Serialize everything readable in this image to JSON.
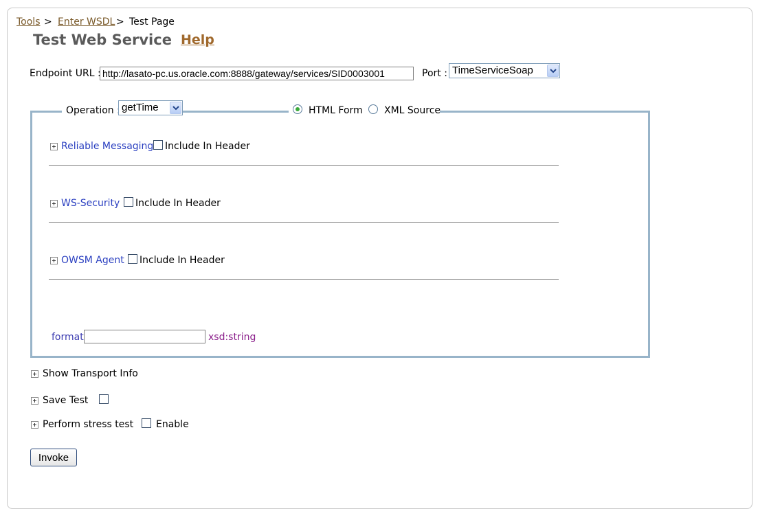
{
  "breadcrumb": {
    "items": [
      {
        "label": "Tools",
        "link": true
      },
      {
        "label": "Enter WSDL",
        "link": true
      },
      {
        "label": "Test Page",
        "link": false
      }
    ],
    "separator": ">"
  },
  "header": {
    "title": "Test Web Service",
    "help_label": "Help"
  },
  "endpoint": {
    "label": "Endpoint URL :",
    "value": "http://lasato-pc.us.oracle.com:8888/gateway/services/SID0003001",
    "port_label": "Port :",
    "port_value": "TimeServiceSoap"
  },
  "operation": {
    "label": "Operation :",
    "value": "getTime",
    "modes": [
      {
        "label": "HTML Form",
        "selected": true
      },
      {
        "label": "XML Source",
        "selected": false
      }
    ]
  },
  "header_sections": [
    {
      "label": "Reliable Messaging",
      "checkbox_label": "Include In Header",
      "checked": false
    },
    {
      "label": "WS-Security",
      "checkbox_label": "Include In Header",
      "checked": false
    },
    {
      "label": "OWSM Agent",
      "checkbox_label": "Include In Header",
      "checked": false
    }
  ],
  "parameters": [
    {
      "name": "format",
      "value": "",
      "type": "xsd:string"
    }
  ],
  "options": {
    "transport": {
      "label": "Show Transport Info"
    },
    "save_test": {
      "label": "Save Test",
      "checked": false
    },
    "stress_test": {
      "label": "Perform stress test",
      "enable_label": "Enable",
      "checked": false
    }
  },
  "invoke_label": "Invoke",
  "colors": {
    "fieldset_border": "#98b4c9",
    "link_blue": "#2a3fc0",
    "help_brown": "#a0692d",
    "type_purple": "#8b1f8b"
  }
}
